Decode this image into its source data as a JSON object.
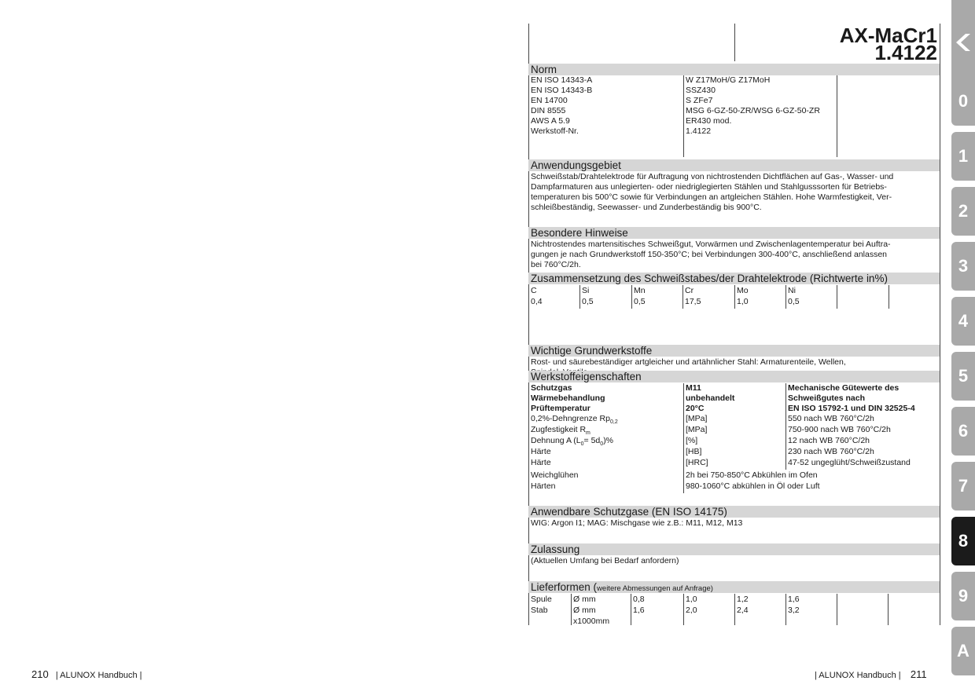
{
  "product": {
    "name": "AX-MaCr1",
    "material_no": "1.4122"
  },
  "norm": {
    "title": "Norm",
    "rows": [
      {
        "standard": "EN ISO 14343-A",
        "designation": "W Z17MoH/G Z17MoH"
      },
      {
        "standard": "EN ISO 14343-B",
        "designation": "SSZ430"
      },
      {
        "standard": "EN 14700",
        "designation": "S ZFe7"
      },
      {
        "standard": "DIN 8555",
        "designation": "MSG 6-GZ-50-ZR/WSG 6-GZ-50-ZR"
      },
      {
        "standard": "AWS A 5.9",
        "designation": "ER430 mod."
      },
      {
        "standard": "Werkstoff-Nr.",
        "designation": "1.4122"
      }
    ]
  },
  "application": {
    "title": "Anwendungsgebiet",
    "lines": [
      "Schweißstab/Drahtelektrode für Auftragung von nichtrostenden Dichtflächen auf Gas-, Wasser- und",
      "Dampfarmaturen aus unlegierten- oder niedriglegierten Stählen und Stahlgusssorten für Betriebs-",
      "temperaturen bis 500°C sowie für Verbindungen an artgleichen Stählen. Hohe Warmfestigkeit, Ver-",
      "schleißbeständig, Seewasser- und Zunderbeständig bis 900°C."
    ]
  },
  "notes": {
    "title": "Besondere Hinweise",
    "lines": [
      "Nichtrostendes martensitisches Schweißgut, Vorwärmen und Zwischenlagentemperatur  bei Auftra-",
      "gungen je nach Grundwerkstoff 150-350°C; bei Verbindungen 300-400°C, anschließend anlassen",
      "bei 760°C/2h."
    ]
  },
  "composition": {
    "title": "Zusammensetzung des Schweißstabes/der Drahtelektrode (Richtwerte in%)",
    "elements": [
      "C",
      "Si",
      "Mn",
      "Cr",
      "Mo",
      "Ni"
    ],
    "values": [
      "0,4",
      "0,5",
      "0,5",
      "17,5",
      "1,0",
      "0,5"
    ]
  },
  "base_materials": {
    "title": "Wichtige Grundwerkstoffe",
    "lines": [
      "Rost- und säurebeständiger artgleicher und artähnlicher Stahl: Armaturenteile, Wellen,",
      "Spindel, Ventile."
    ]
  },
  "properties": {
    "title": "Werkstoffeigenschaften",
    "head_left": [
      "Schutzgas",
      "Wärmebehandlung",
      "Prüftemperatur"
    ],
    "head_mid": [
      "M11",
      "unbehandelt",
      "20°C"
    ],
    "head_right": [
      "Mechanische Gütewerte des",
      "Schweißgutes nach",
      "EN ISO 15792-1 und DIN 32525-4"
    ],
    "rows": [
      {
        "label": "0,2%-Dehngrenze Rp",
        "sub": "0,2",
        "suffix": "",
        "unit": "[MPa]",
        "value": "550 nach WB 760°C/2h"
      },
      {
        "label": "Zugfestigkeit R",
        "sub": "m",
        "suffix": "",
        "unit": "[MPa]",
        "value": "750-900  nach WB 760°C/2h"
      },
      {
        "label": "Dehnung A (L",
        "sub": "0",
        "suffix": "= 5d",
        "sub2": "0",
        "suffix2": ")%",
        "unit": "[%]",
        "value": "12  nach WB 760°C/2h"
      },
      {
        "label": "Härte",
        "sub": "",
        "suffix": "",
        "unit": "[HB]",
        "value": "230  nach WB 760°C/2h"
      },
      {
        "label": "Härte",
        "sub": "",
        "suffix": "",
        "unit": "[HRC]",
        "value": "47-52 ungeglüht/Schweißzustand"
      }
    ],
    "treatments": [
      {
        "label": "Weichglühen",
        "value": "2h bei 750-850°C  Abkühlen im Ofen"
      },
      {
        "label": "Härten",
        "value": "980-1060°C abkühlen in Öl oder Luft"
      }
    ]
  },
  "gases": {
    "title": "Anwendbare Schutzgase (EN ISO 14175)",
    "text": "WIG: Argon I1; MAG: Mischgase wie z.B.: M11, M12, M13"
  },
  "approval": {
    "title": "Zulassung",
    "text": "(Aktuellen Umfang bei Bedarf anfordern)"
  },
  "delivery": {
    "title": "Lieferformen (",
    "title_small": "weitere Abmessungen auf Anfrage)",
    "rows": [
      {
        "form": "Spule",
        "unit": "Ø  mm",
        "unit2": "",
        "sizes": [
          "0,8",
          "1,0",
          "1,2",
          "1,6"
        ]
      },
      {
        "form": "Stab",
        "unit": "Ø  mm",
        "unit2": "x1000mm",
        "sizes": [
          "1,6",
          "2,0",
          "2,4",
          "3,2"
        ]
      }
    ]
  },
  "footer": {
    "left_page": "210",
    "left_text": "| ALUNOX Handbuch |",
    "right_text": "| ALUNOX Handbuch |",
    "right_page": "211"
  },
  "tabs": [
    "0",
    "1",
    "2",
    "3",
    "4",
    "5",
    "6",
    "7",
    "8",
    "9",
    "A"
  ],
  "active_tab": "8",
  "colors": {
    "header_bg": "#d6d6d6",
    "tab_bg": "#a9a9a9",
    "tab_active": "#1b1b1b"
  }
}
